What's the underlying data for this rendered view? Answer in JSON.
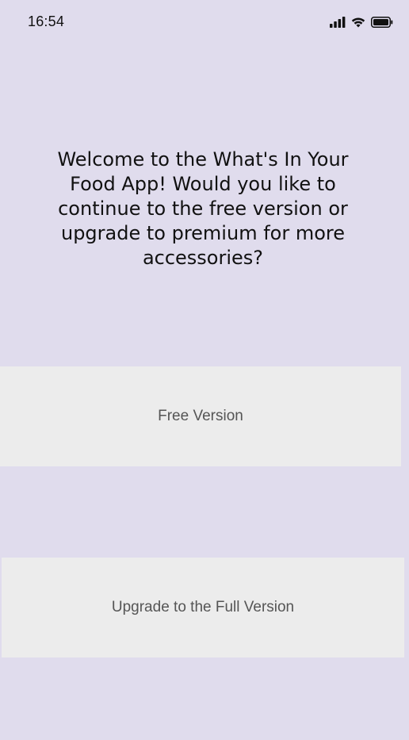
{
  "status_bar": {
    "time": "16:54",
    "icons": [
      "signal-icon",
      "wifi-icon",
      "battery-icon"
    ]
  },
  "welcome": {
    "message": "Welcome to the What's In Your Food App! Would you like to continue to the free version or upgrade to premium for more accessories?"
  },
  "buttons": {
    "free_label": "Free Version",
    "upgrade_label": "Upgrade to the Full Version"
  },
  "colors": {
    "background": "#e0dced",
    "button_background": "#ececec",
    "button_text": "#555555",
    "text": "#111111"
  }
}
